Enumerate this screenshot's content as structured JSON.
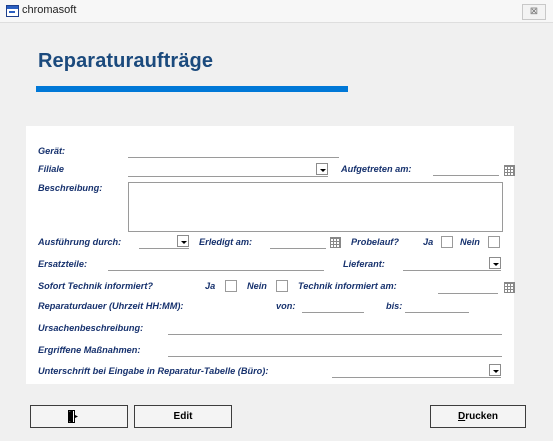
{
  "window": {
    "title": "chromasoft",
    "close_glyph": "⊠"
  },
  "form": {
    "heading": "Reparaturaufträge",
    "accent_color": "#0078d7",
    "label_color": "#17326e"
  },
  "fields": {
    "geraet": {
      "label": "Gerät:"
    },
    "filiale": {
      "label": "Filiale"
    },
    "aufgetreten": {
      "label": "Aufgetreten am:"
    },
    "beschreibung": {
      "label": "Beschreibung:"
    },
    "ausfuehrung": {
      "label": "Ausführung durch:"
    },
    "erledigt": {
      "label": "Erledigt am:"
    },
    "probelauf": {
      "label": "Probelauf?",
      "ja": "Ja",
      "nein": "Nein"
    },
    "ersatzteile": {
      "label": "Ersatzteile:"
    },
    "lieferant": {
      "label": "Lieferant:"
    },
    "sofort": {
      "label": "Sofort Technik informiert?",
      "ja": "Ja",
      "nein": "Nein"
    },
    "technik_am": {
      "label": "Technik informiert am:"
    },
    "reparaturdauer": {
      "label": "Reparaturdauer (Uhrzeit HH:MM):",
      "von": "von:",
      "bis": "bis:"
    },
    "ursachen": {
      "label": "Ursachenbeschreibung:"
    },
    "massnahmen": {
      "label": "Ergriffene Maßnahmen:"
    },
    "unterschrift": {
      "label": "Unterschrift bei Eingabe in Reparatur-Tabelle (Büro):"
    }
  },
  "buttons": {
    "exit_icon": "exit-door-icon",
    "edit": "Edit",
    "drucken_first": "D",
    "drucken_rest": "rucken"
  }
}
